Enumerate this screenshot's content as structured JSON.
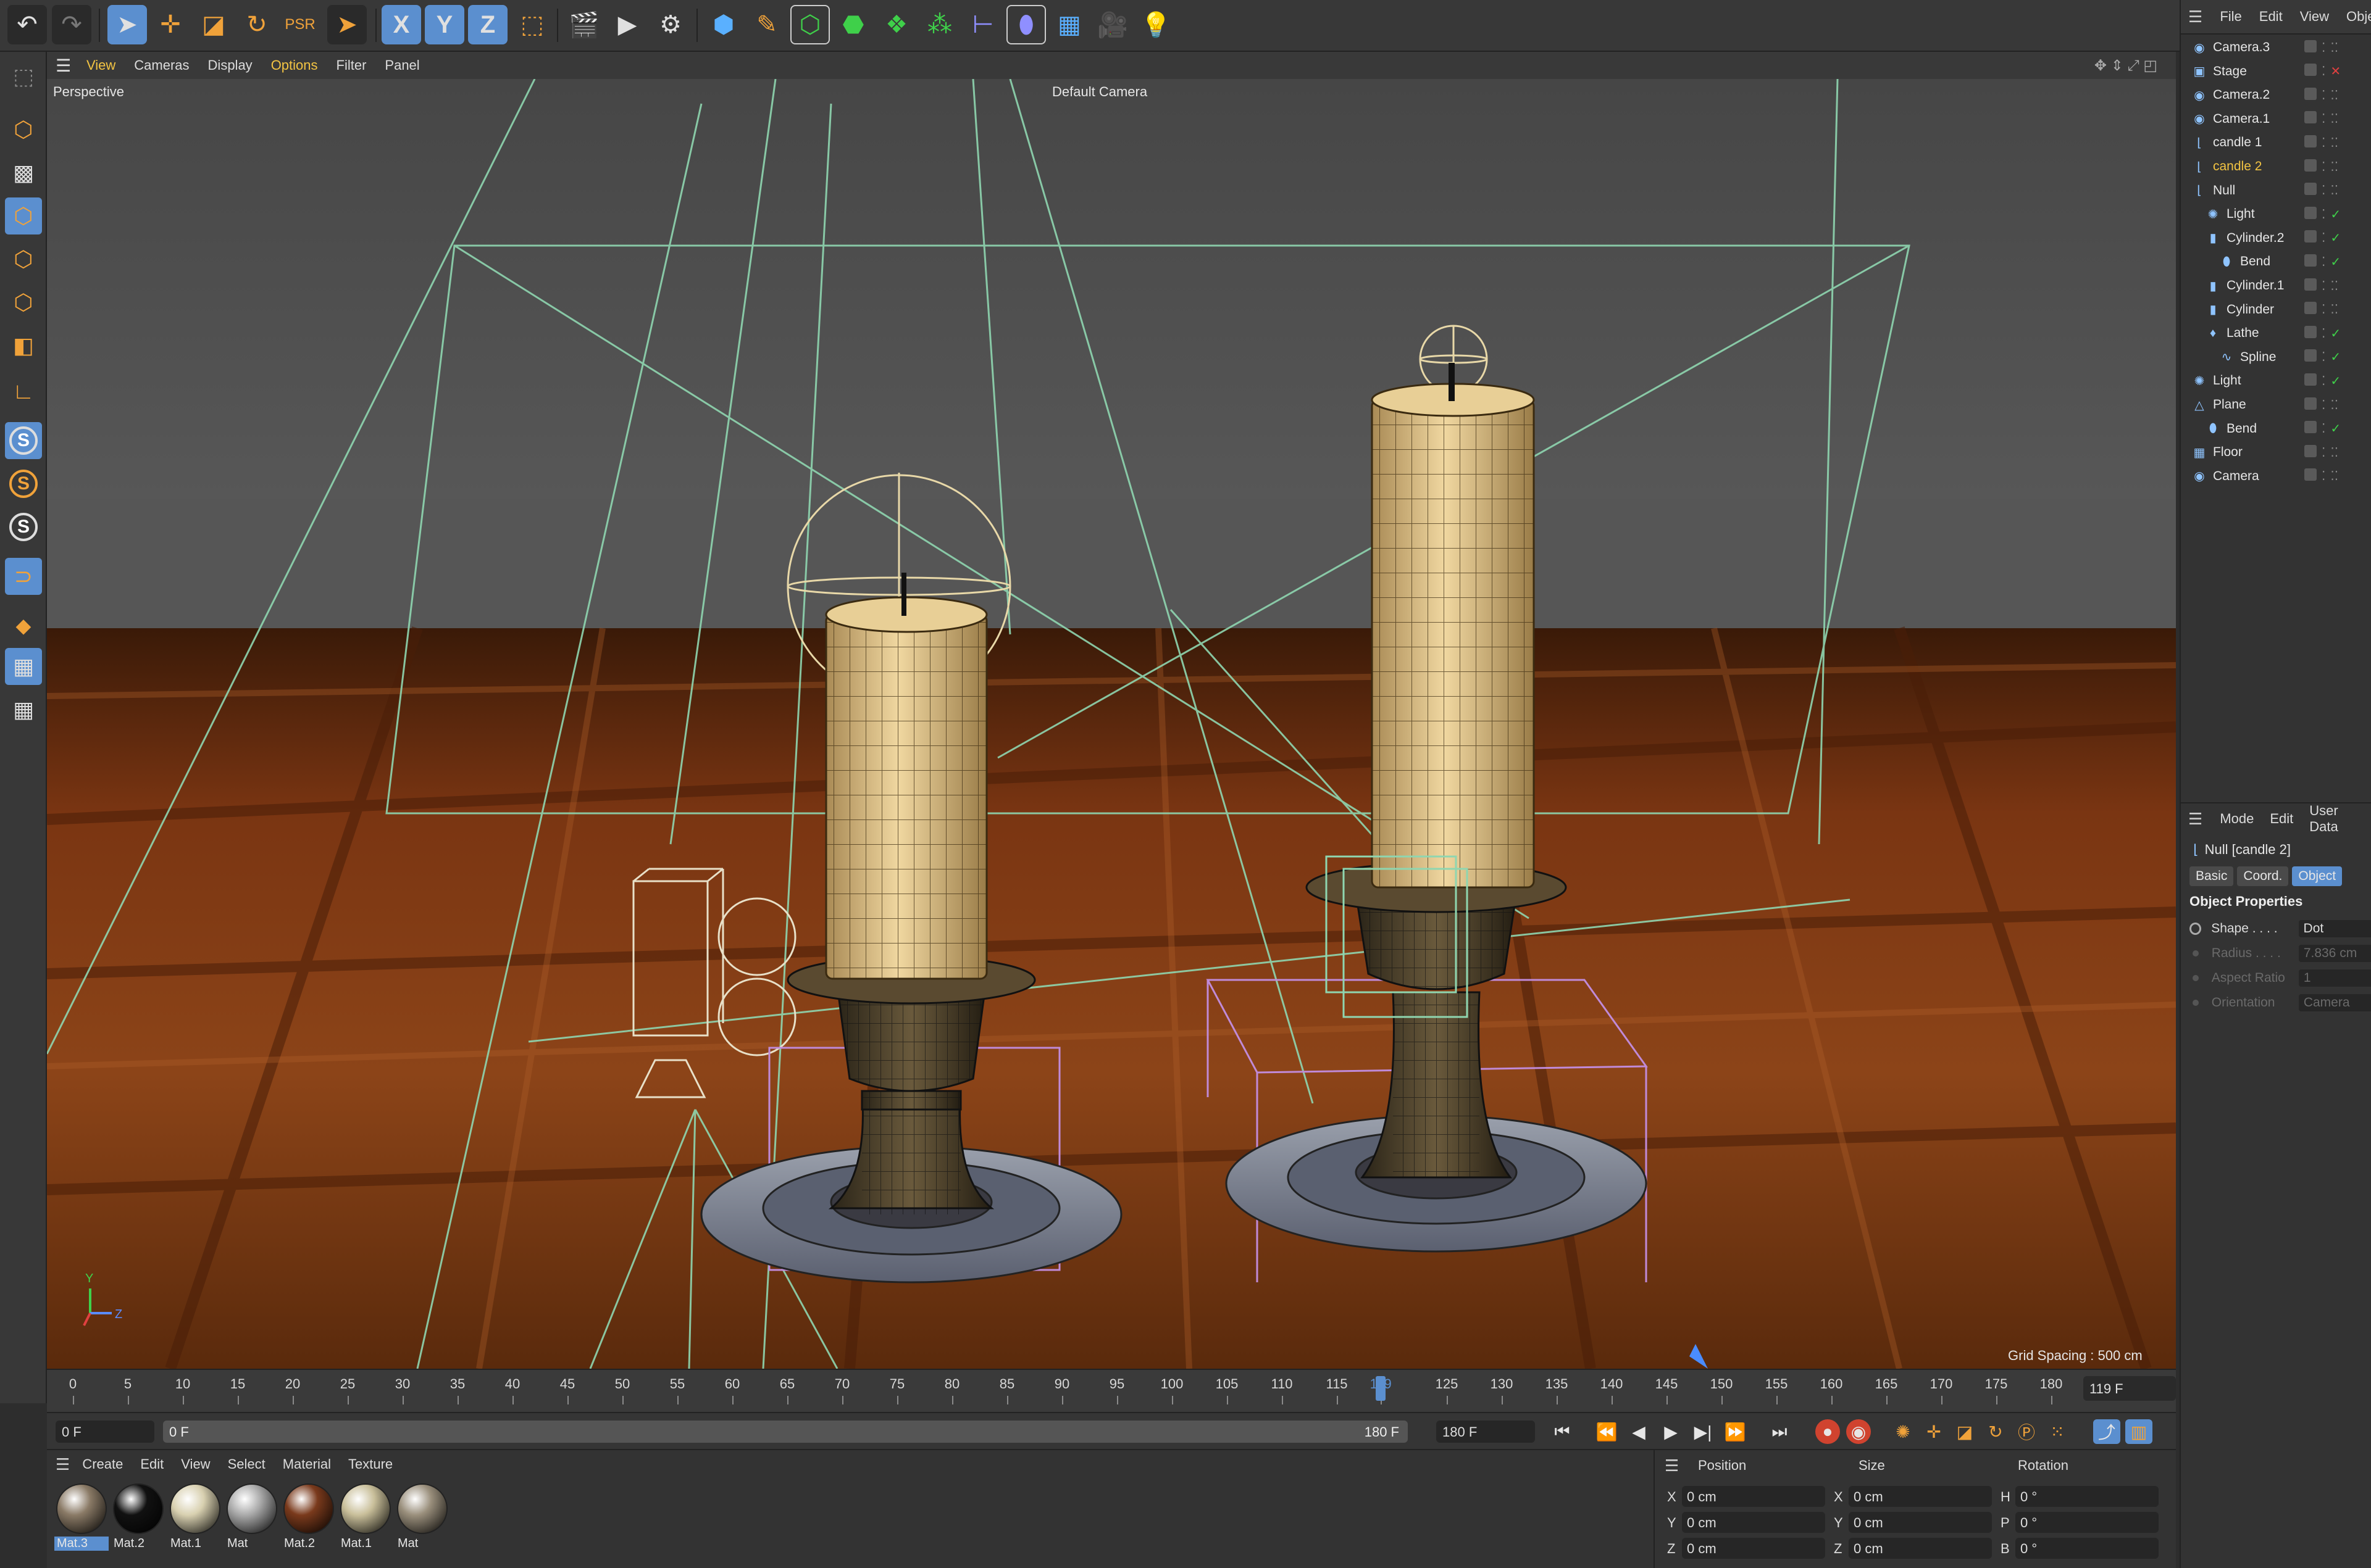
{
  "toolbar": {
    "undo": "undo-icon",
    "redo": "redo-icon",
    "axis_x": "X",
    "axis_y": "Y",
    "axis_z": "Z"
  },
  "viewport": {
    "menu": [
      "View",
      "Cameras",
      "Display",
      "Options",
      "Filter",
      "Panel"
    ],
    "projection": "Perspective",
    "camera": "Default Camera",
    "grid_spacing": "Grid Spacing : 500 cm",
    "axis_y": "Y",
    "axis_z": "Z"
  },
  "timeline": {
    "ticks": [
      "0",
      "5",
      "10",
      "15",
      "20",
      "25",
      "30",
      "35",
      "40",
      "45",
      "50",
      "55",
      "60",
      "65",
      "70",
      "75",
      "80",
      "85",
      "90",
      "95",
      "100",
      "105",
      "110",
      "115",
      "119",
      "125",
      "130",
      "135",
      "140",
      "145",
      "150",
      "155",
      "160",
      "165",
      "170",
      "175",
      "180"
    ],
    "current_frame_field": "119 F"
  },
  "transport": {
    "start_field": "0 F",
    "range_start": "0 F",
    "range_end": "180 F",
    "end_field": "180 F"
  },
  "materials": {
    "menu": [
      "Create",
      "Edit",
      "View",
      "Select",
      "Material",
      "Texture"
    ],
    "items": [
      {
        "name": "Mat.3",
        "color": "#8a7a66"
      },
      {
        "name": "Mat.2",
        "color": "#111111"
      },
      {
        "name": "Mat.1",
        "color": "#d8d0b0"
      },
      {
        "name": "Mat",
        "color": "#aaaaaa"
      },
      {
        "name": "Mat.2",
        "color": "#7a3a1c"
      },
      {
        "name": "Mat.1",
        "color": "#c9bf9a"
      },
      {
        "name": "Mat",
        "color": "#9a8f7c"
      }
    ]
  },
  "coords": {
    "headers": [
      "Position",
      "Size",
      "Rotation"
    ],
    "rows": [
      {
        "a1": "X",
        "v1": "0 cm",
        "a2": "X",
        "v2": "0 cm",
        "a3": "H",
        "v3": "0 °"
      },
      {
        "a1": "Y",
        "v1": "0 cm",
        "a2": "Y",
        "v2": "0 cm",
        "a3": "P",
        "v3": "0 °"
      },
      {
        "a1": "Z",
        "v1": "0 cm",
        "a2": "Z",
        "v2": "0 cm",
        "a3": "B",
        "v3": "0 °"
      }
    ]
  },
  "object_manager": {
    "menu": [
      "File",
      "Edit",
      "View",
      "Obje"
    ],
    "objects": [
      {
        "name": "Camera.3",
        "icon": "camera-icon",
        "indent": 0,
        "state": "dots"
      },
      {
        "name": "Stage",
        "icon": "stage-icon",
        "indent": 0,
        "state": "x"
      },
      {
        "name": "Camera.2",
        "icon": "camera-icon",
        "indent": 0,
        "state": "dots"
      },
      {
        "name": "Camera.1",
        "icon": "camera-icon",
        "indent": 0,
        "state": "dots"
      },
      {
        "name": "candle 1",
        "icon": "null-icon",
        "indent": 0,
        "state": "dots"
      },
      {
        "name": "candle 2",
        "icon": "null-icon",
        "indent": 0,
        "state": "dots",
        "highlight": true
      },
      {
        "name": "Null",
        "icon": "null-icon",
        "indent": 0,
        "state": "dots"
      },
      {
        "name": "Light",
        "icon": "light-icon",
        "indent": 1,
        "state": "check"
      },
      {
        "name": "Cylinder.2",
        "icon": "cylinder-icon",
        "indent": 1,
        "state": "check"
      },
      {
        "name": "Bend",
        "icon": "bend-icon",
        "indent": 2,
        "state": "check"
      },
      {
        "name": "Cylinder.1",
        "icon": "cylinder-icon",
        "indent": 1,
        "state": "dots"
      },
      {
        "name": "Cylinder",
        "icon": "cylinder-icon",
        "indent": 1,
        "state": "dots"
      },
      {
        "name": "Lathe",
        "icon": "lathe-icon",
        "indent": 1,
        "state": "check"
      },
      {
        "name": "Spline",
        "icon": "spline-icon",
        "indent": 2,
        "state": "check"
      },
      {
        "name": "Light",
        "icon": "light-icon",
        "indent": 0,
        "state": "check"
      },
      {
        "name": "Plane",
        "icon": "plane-icon",
        "indent": 0,
        "state": "dots"
      },
      {
        "name": "Bend",
        "icon": "bend-icon",
        "indent": 1,
        "state": "check"
      },
      {
        "name": "Floor",
        "icon": "floor-icon",
        "indent": 0,
        "state": "dots"
      },
      {
        "name": "Camera",
        "icon": "camera-icon",
        "indent": 0,
        "state": "dots"
      }
    ]
  },
  "attribute_manager": {
    "menu": [
      "Mode",
      "Edit",
      "User Data"
    ],
    "title": "Null [candle 2]",
    "tabs": [
      "Basic",
      "Coord.",
      "Object"
    ],
    "active_tab": "Object",
    "section": "Object Properties",
    "props": [
      {
        "label": "Shape . . . .",
        "value": "Dot",
        "enabled": true
      },
      {
        "label": "Radius . . . .",
        "value": "7.836 cm",
        "enabled": false
      },
      {
        "label": "Aspect Ratio",
        "value": "1",
        "enabled": false
      },
      {
        "label": "Orientation",
        "value": "Camera",
        "enabled": false
      }
    ]
  },
  "colors": {
    "accent": "#5b8fcf",
    "highlight": "#f3c443",
    "floor": "#7a3512",
    "wax": "#d9c08a"
  }
}
